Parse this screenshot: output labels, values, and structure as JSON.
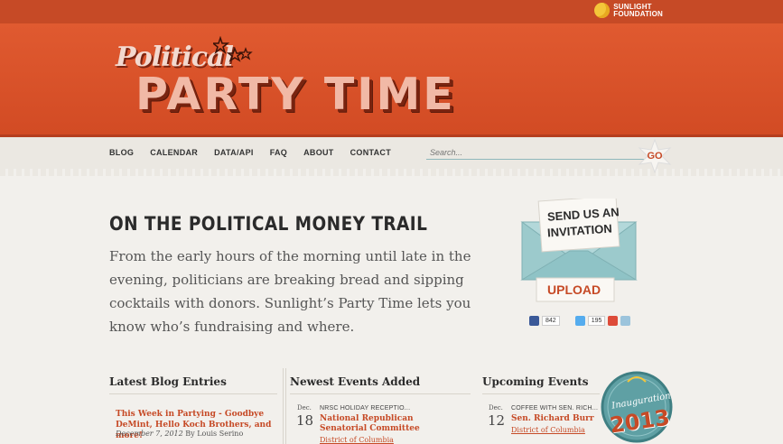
{
  "header": {
    "sunlight_line1": "SUNLIGHT",
    "sunlight_line2": "FOUNDATION",
    "logo_script": "Political",
    "logo_main": "PARTY TIME"
  },
  "nav": {
    "items": [
      "BLOG",
      "CALENDAR",
      "DATA/API",
      "FAQ",
      "ABOUT",
      "CONTACT"
    ]
  },
  "search": {
    "placeholder": "Search...",
    "go_label": "GO"
  },
  "hero": {
    "title": "ON THE POLITICAL MONEY TRAIL",
    "body": "From the early hours of the morning until late in the evening, politicians are breaking bread and sipping cocktails with donors. Sunlight’s Party Time lets you know who’s fundraising and where."
  },
  "invite": {
    "line1": "SEND US AN",
    "line2": "INVITATION",
    "upload_label": "UPLOAD"
  },
  "share": {
    "facebook_count": "842",
    "twitter_count": "195"
  },
  "columns": {
    "blog": {
      "heading": "Latest Blog Entries",
      "title": "This Week in Partying - Goodbye DeMint, Hello Koch Brothers, and more!",
      "date": "December 7, 2012",
      "author_prefix": "By",
      "author": "Louis Serino"
    },
    "newest": {
      "heading": "Newest Events Added",
      "month": "Dec.",
      "day": "18",
      "tag": "NRSC HOLIDAY RECEPTIO...",
      "name": "National Republican Senatorial Committee",
      "location": "District of Columbia"
    },
    "upcoming": {
      "heading": "Upcoming Events",
      "month": "Dec.",
      "day": "12",
      "tag": "COFFEE WITH SEN. RICH...",
      "name": "Sen. Richard Burr",
      "location": "District of Columbia"
    }
  },
  "badge": {
    "script": "Inauguration",
    "year": "2013"
  },
  "colors": {
    "brand_orange": "#d24b24",
    "accent_red": "#c64a26",
    "teal": "#8fc3c6"
  }
}
